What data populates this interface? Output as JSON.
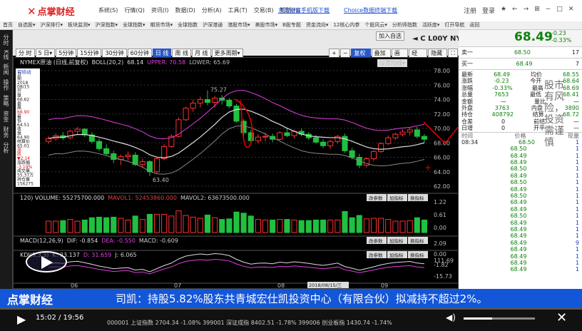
{
  "app": {
    "name": "点掌财经",
    "menu": [
      "系统(S)",
      "行情(Q)",
      "资讯(I)",
      "数据(D)",
      "分析(A)",
      "工具(T)",
      "交易(B)",
      "帮助(H)"
    ],
    "promo_links": [
      "东方财富手机版下载",
      "Choice数据终端下载"
    ],
    "window_controls": [
      "注册",
      "登录",
      "★",
      "←",
      "→",
      "⊞",
      "−",
      "□",
      "✕"
    ]
  },
  "nav": {
    "items": [
      "首页",
      "自选股▾",
      "沪深排行▾",
      "板块监测▾",
      "沪深指数▾",
      "全球指数▾",
      "期货市场▾",
      "全球指数",
      "沪深港通",
      "港股市场▾",
      "美股市场▾",
      "B股专题",
      "资金流向▾",
      "12核心内参",
      "个股风云▾",
      "分析师指数",
      "活跃度▾",
      "打开导航",
      "返回"
    ]
  },
  "left_nav": {
    "items": [
      "分时",
      "K线",
      "新闻",
      "操作",
      "策略",
      "资金",
      "财务",
      "分析"
    ]
  },
  "toolbar": {
    "periods": [
      "分 时",
      "5 日▾",
      "5分钟",
      "15分钟",
      "30分钟",
      "60分钟",
      "日 线",
      "周 线",
      "月 线",
      "更多周期▾"
    ],
    "active_period": "日 线",
    "right_buttons": [
      "+",
      "−",
      "复权▾",
      "叠加▾",
      "画线",
      "经 典",
      "隐藏▸",
      "⛶"
    ],
    "actions": [
      "加入自选",
      "◄",
      "C L00Y NYMEX原油",
      "▶"
    ],
    "price_header": "68.49",
    "price_change": "-0.23",
    "price_pct": "-0.33%",
    "settings_btn": "设置均线▾"
  },
  "chart": {
    "main_legend": {
      "name": "NYMEX原油 (日线,前复权)",
      "boll": "BOLL(20,2)",
      "boll_val": "68.14",
      "upper": "UPPER: 70.58",
      "lower": "LOWER: 65.69"
    },
    "info_box": {
      "title": "可结动",
      "items": [
        "日",
        "期",
        "2018",
        "08/15",
        "开",
        "盘",
        "66.62",
        "最",
        "高",
        "66.90",
        "最",
        "低",
        "64.51",
        "收",
        "盘",
        "64.90",
        "结算价",
        "65.01",
        "涨",
        "跌",
        "▼2.14",
        "涨跌幅",
        "-3.19%",
        "成交量",
        "55.37万",
        "持仓量",
        "156275"
      ]
    },
    "y_labels": [
      "78.00",
      "76.00",
      "74.00",
      "72.00",
      "70.00",
      "68.00",
      "66.00",
      "64.00",
      "62.00"
    ],
    "annotations": [
      "75.27",
      "63.40"
    ],
    "vol_legend": {
      "label": "120) VOLUME: 55275700.000",
      "ma1": "MAVOL1: 52453860.000",
      "ma2": "MAVOL2: 63673500.000"
    },
    "vol_y": [
      "1.22",
      "0.61",
      "0.00"
    ],
    "macd_legend": {
      "label": "MACD(12,26,9)",
      "dif": "DIF: -0.854",
      "dea": "DEA: -0.550",
      "macd": "MACD: -0.609"
    },
    "macd_y": [
      "2.09",
      "0.00",
      "-1.82"
    ],
    "kdj_legend": {
      "label": "KDJ(9,3,3)",
      "k": "K: 23.137",
      "d": "D: 31.659",
      "j": "J: 6.065"
    },
    "kdj_y": [
      "111.69",
      "-15.73"
    ],
    "sub_buttons": [
      "改参数",
      "加指标",
      "换指标"
    ],
    "x_labels": [
      "06",
      "07",
      "08",
      "09"
    ],
    "date_box": "2018/08/15/三"
  },
  "quote": {
    "header": {
      "code": "C L00Y",
      "name": "NYMEX原油",
      "price": "68.49",
      "change": "-0.23",
      "pct": "-0.33%"
    },
    "sell": {
      "label": "卖一",
      "price": "68.50",
      "vol": "17"
    },
    "buy": {
      "label": "买一",
      "price": "68.49",
      "vol": "7"
    },
    "fields": [
      [
        "最新",
        "68.49",
        "均价",
        "68.55"
      ],
      [
        "涨跌",
        "-0.23",
        "今开",
        "68.64"
      ],
      [
        "涨幅",
        "-0.33%",
        "最高",
        "68.69"
      ],
      [
        "总量",
        "7653",
        "最低",
        "68.41"
      ],
      [
        "金额",
        "—",
        "量比",
        "—"
      ],
      [
        "外盘",
        "3763",
        "内盘",
        "3890"
      ],
      [
        "持仓",
        "408792",
        "结算",
        "68.72"
      ],
      [
        "仓差",
        "0",
        "前结",
        "—"
      ],
      [
        "日增",
        "0",
        "开平",
        "—"
      ]
    ],
    "ticks_header": [
      "时间",
      "价格",
      "现量"
    ],
    "ticks": [
      [
        "08:34",
        "68.50",
        "1"
      ],
      [
        "",
        "68.50",
        "1"
      ],
      [
        "",
        "68.49",
        "1"
      ],
      [
        "",
        "68.49",
        "1"
      ],
      [
        "",
        "68.50",
        "1"
      ],
      [
        "",
        "68.49",
        "1"
      ],
      [
        "",
        "68.50",
        "1"
      ],
      [
        "",
        "68.49",
        "1"
      ],
      [
        "",
        "68.50",
        "1"
      ],
      [
        "",
        "68.49",
        "1"
      ],
      [
        "",
        "68.49",
        "1"
      ],
      [
        "",
        "68.50",
        "1"
      ],
      [
        "",
        "68.49",
        "1"
      ],
      [
        "",
        "68.49",
        "1"
      ],
      [
        "",
        "68.49",
        "1"
      ],
      [
        "",
        "68.49",
        "9"
      ],
      [
        "",
        "68.49",
        "1"
      ],
      [
        "",
        "68.49",
        "1"
      ],
      [
        "",
        "68.49",
        "1"
      ],
      [
        "",
        "68.49",
        "1"
      ]
    ],
    "handwritten": "股市有风险，投资需谨慎"
  },
  "ticker": {
    "logo": "点掌财经",
    "text": "司凯：持股5.82%股东共青城宏仕凯投资中心（有限合伙）拟减持不超过2%。"
  },
  "player": {
    "time": "15:02 / 19:56",
    "index_line": "000001 上证指数 2704.34 -1.08%  399001 深证成指 8402.51 -1.78%  399006 创业板指 1430.74 -1.74%"
  },
  "chart_data": {
    "type": "candlestick",
    "title": "NYMEX原油 (日线,前复权)",
    "ylim": [
      62,
      78
    ],
    "ohlc": [
      [
        68.2,
        68.9,
        67.9,
        68.6
      ],
      [
        68.6,
        69.3,
        68.3,
        69.0
      ],
      [
        69.0,
        69.5,
        68.4,
        68.7
      ],
      [
        68.7,
        69.8,
        68.5,
        69.6
      ],
      [
        69.6,
        70.2,
        69.2,
        69.9
      ],
      [
        69.9,
        70.0,
        68.8,
        69.1
      ],
      [
        69.1,
        69.5,
        67.9,
        68.2
      ],
      [
        68.2,
        68.6,
        66.9,
        67.2
      ],
      [
        67.2,
        67.8,
        66.2,
        66.5
      ],
      [
        66.5,
        66.9,
        65.2,
        65.7
      ],
      [
        65.7,
        66.4,
        64.9,
        66.1
      ],
      [
        66.1,
        66.8,
        65.6,
        66.3
      ],
      [
        66.3,
        66.7,
        64.8,
        65.0
      ],
      [
        65.0,
        65.8,
        64.5,
        65.4
      ],
      [
        65.4,
        65.6,
        63.4,
        64.0
      ],
      [
        64.0,
        66.0,
        63.8,
        65.8
      ],
      [
        65.8,
        67.8,
        65.6,
        67.5
      ],
      [
        67.5,
        69.2,
        67.3,
        68.9
      ],
      [
        68.9,
        71.5,
        68.7,
        71.2
      ],
      [
        71.2,
        73.0,
        71.0,
        72.8
      ],
      [
        72.8,
        74.0,
        72.3,
        73.5
      ],
      [
        73.5,
        74.4,
        72.9,
        74.0
      ],
      [
        74.0,
        75.27,
        73.2,
        73.6
      ],
      [
        73.6,
        74.5,
        72.9,
        74.2
      ],
      [
        74.2,
        74.6,
        73.3,
        73.9
      ],
      [
        73.9,
        74.2,
        72.8,
        73.1
      ],
      [
        73.1,
        73.4,
        70.8,
        71.0
      ],
      [
        71.0,
        71.3,
        68.9,
        69.4
      ],
      [
        69.4,
        69.8,
        67.9,
        68.3
      ],
      [
        68.3,
        69.2,
        67.9,
        68.8
      ],
      [
        68.8,
        69.4,
        68.2,
        68.9
      ],
      [
        68.9,
        69.3,
        68.1,
        68.5
      ],
      [
        68.5,
        69.6,
        68.3,
        69.4
      ],
      [
        69.4,
        70.1,
        68.8,
        69.0
      ],
      [
        69.0,
        69.8,
        68.6,
        69.6
      ],
      [
        69.6,
        70.0,
        68.9,
        69.2
      ],
      [
        69.2,
        69.5,
        68.4,
        68.7
      ],
      [
        68.7,
        69.1,
        67.9,
        68.1
      ],
      [
        68.1,
        68.5,
        67.3,
        67.6
      ],
      [
        67.6,
        68.4,
        67.2,
        68.2
      ],
      [
        68.2,
        69.1,
        67.9,
        68.9
      ],
      [
        68.9,
        69.3,
        66.6,
        66.9
      ],
      [
        66.9,
        67.3,
        65.7,
        66.0
      ],
      [
        66.0,
        66.5,
        64.5,
        64.9
      ],
      [
        64.9,
        66.0,
        64.6,
        65.8
      ],
      [
        65.8,
        67.0,
        65.5,
        66.8
      ],
      [
        66.8,
        68.1,
        66.6,
        67.9
      ],
      [
        67.9,
        69.0,
        67.7,
        68.7
      ],
      [
        68.7,
        69.4,
        68.4,
        69.2
      ],
      [
        69.2,
        69.9,
        68.9,
        69.5
      ],
      [
        69.5,
        70.1,
        69.0,
        69.8
      ],
      [
        69.8,
        70.2,
        68.6,
        68.9
      ],
      [
        68.9,
        69.2,
        68.0,
        68.49
      ]
    ]
  }
}
